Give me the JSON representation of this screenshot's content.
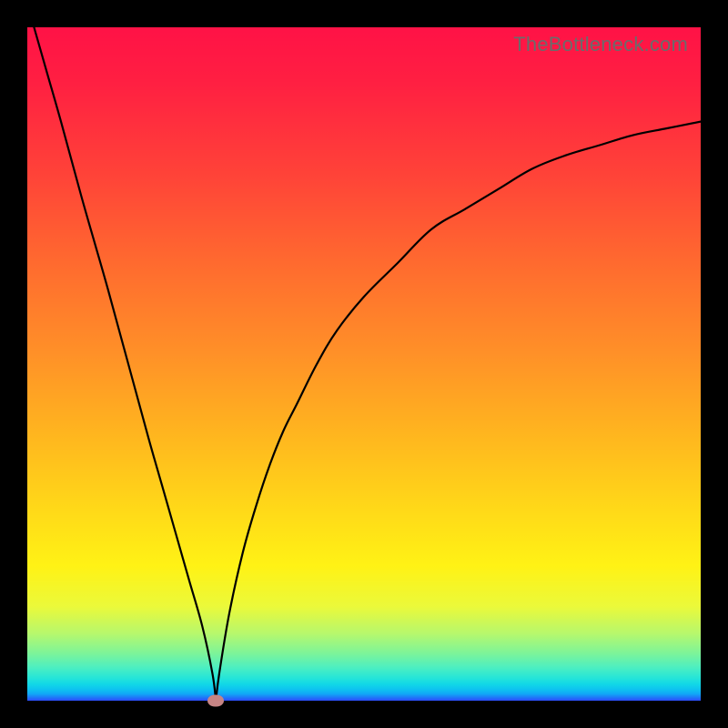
{
  "domain": "Chart",
  "watermark": "TheBottleneck.com",
  "colors": {
    "background": "#000000",
    "top": "#ff1246",
    "bottom": "#2e4bfa",
    "curve": "#000000",
    "marker": "#c68484"
  },
  "chart_data": {
    "type": "line",
    "title": "",
    "xlabel": "",
    "ylabel": "",
    "xlim": [
      0,
      100
    ],
    "ylim": [
      0,
      100
    ],
    "grid": false,
    "legend": false,
    "vertex_x": 28,
    "series": [
      {
        "name": "left-branch",
        "x": [
          1,
          3,
          5,
          8,
          10,
          12,
          15,
          18,
          20,
          22,
          24,
          26,
          27.5,
          28
        ],
        "y": [
          100,
          93,
          86,
          75,
          68,
          61,
          50,
          39,
          32,
          25,
          18,
          11,
          4,
          0
        ]
      },
      {
        "name": "right-branch",
        "x": [
          28,
          28.5,
          30,
          32,
          34,
          36,
          38,
          40,
          43,
          46,
          50,
          55,
          60,
          65,
          70,
          75,
          80,
          85,
          90,
          95,
          100
        ],
        "y": [
          0,
          4,
          13,
          22,
          29,
          35,
          40,
          44,
          50,
          55,
          60,
          65,
          70,
          73,
          76,
          79,
          81,
          82.5,
          84,
          85,
          86
        ]
      }
    ],
    "marker": {
      "x": 28,
      "y": 0
    }
  }
}
